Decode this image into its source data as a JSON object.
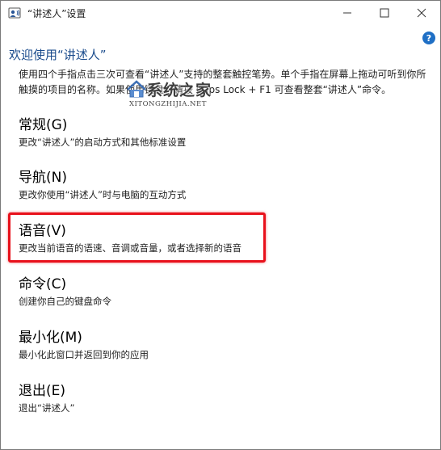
{
  "window": {
    "title": "“讲述人”设置",
    "icon": "narrator-icon"
  },
  "controls": {
    "minimize_icon": "minimize-icon",
    "maximize_icon": "maximize-icon",
    "close_icon": "close-icon",
    "help_label": "?"
  },
  "welcome": "欢迎使用“讲述人”",
  "intro": "使用四个手指点击三次可查看“讲述人”支持的整套触控笔势。单个手指在屏幕上拖动可听到你所触摸的项目的名称。如果使用键盘，请按 Caps Lock + F1 可查看整套“讲述人”命令。",
  "menu": [
    {
      "title": "常规(G)",
      "desc": "更改“讲述人”的启动方式和其他标准设置"
    },
    {
      "title": "导航(N)",
      "desc": "更改你使用“讲述人”时与电脑的互动方式"
    },
    {
      "title": "语音(V)",
      "desc": "更改当前语音的语速、音调或音量，或者选择新的语音"
    },
    {
      "title": "命令(C)",
      "desc": "创建你自己的键盘命令"
    },
    {
      "title": "最小化(M)",
      "desc": "最小化此窗口并返回到你的应用"
    },
    {
      "title": "退出(E)",
      "desc": "退出“讲述人”"
    }
  ],
  "highlight_color": "#e8111b",
  "accent_color": "#1a4b8c",
  "watermark": {
    "title": "系统之家",
    "subtitle": "XITONGZHIJIA.NET"
  }
}
